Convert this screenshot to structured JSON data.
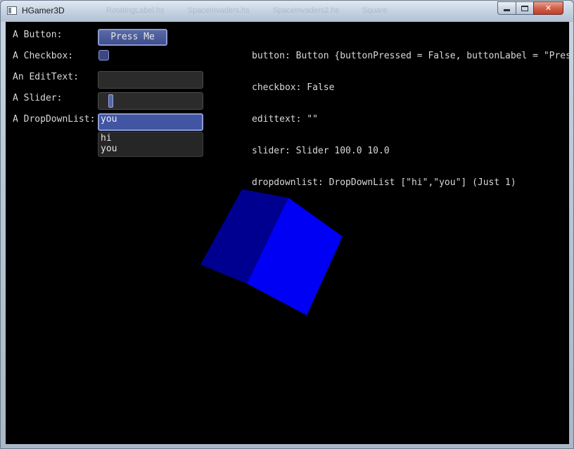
{
  "window": {
    "title": "HGamer3D",
    "background_tabs": [
      "RotatingLabel.hs",
      "SpaceInvaders.hs",
      "SpaceInvaders2.hs",
      "Square"
    ]
  },
  "gui": {
    "button": {
      "label": "A Button:",
      "text": "Press Me"
    },
    "checkbox": {
      "label": "A Checkbox:",
      "checked": false
    },
    "edittext": {
      "label": "An EditText:",
      "value": ""
    },
    "slider": {
      "label": "A Slider:",
      "max": 100.0,
      "value": 10.0
    },
    "dropdown": {
      "label": "A DropDownList:",
      "selected": "you",
      "options": [
        "hi",
        "you"
      ]
    }
  },
  "status": [
    "button: Button {buttonPressed = False, buttonLabel = \"Press Me\"}",
    "checkbox: False",
    "edittext: \"\"",
    "slider: Slider 100.0 10.0",
    "dropdownlist: DropDownList [\"hi\",\"you\"] (Just 1)"
  ],
  "colors": {
    "cube_front": "#0000f5",
    "cube_side": "#000090",
    "gui_accent": "#4255a3",
    "background": "#000000"
  }
}
